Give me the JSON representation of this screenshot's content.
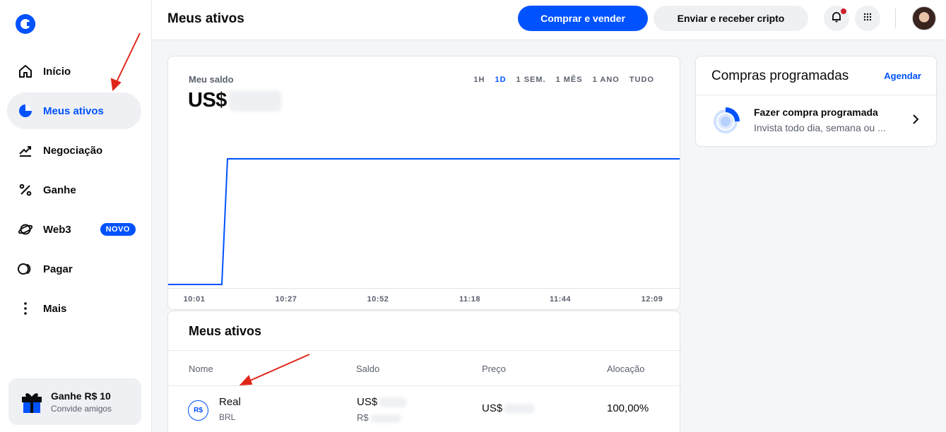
{
  "sidebar": {
    "items": [
      {
        "label": "Início",
        "icon": "home-icon"
      },
      {
        "label": "Meus ativos",
        "icon": "pie-chart-icon"
      },
      {
        "label": "Negociação",
        "icon": "trend-icon"
      },
      {
        "label": "Ganhe",
        "icon": "percent-icon"
      },
      {
        "label": "Web3",
        "icon": "planet-icon",
        "badge": "NOVO"
      },
      {
        "label": "Pagar",
        "icon": "pay-icon"
      },
      {
        "label": "Mais",
        "icon": "more-vertical-icon"
      }
    ],
    "promo": {
      "title": "Ganhe R$ 10",
      "subtitle": "Convide amigos"
    }
  },
  "header": {
    "title": "Meus ativos",
    "buy_sell": "Comprar e vender",
    "send_receive": "Enviar e receber cripto"
  },
  "balance": {
    "label": "Meu saldo",
    "currency": "US$",
    "ranges": [
      "1H",
      "1D",
      "1 SEM.",
      "1 MÊS",
      "1 ANO",
      "TUDO"
    ],
    "active_range": "1D"
  },
  "chart_data": {
    "type": "line",
    "x_ticks": [
      "10:01",
      "10:27",
      "10:52",
      "11:18",
      "11:44",
      "12:09"
    ],
    "series": [
      {
        "values_normalized": [
          0,
          0,
          1,
          1,
          1,
          1
        ]
      }
    ],
    "grid": false,
    "color": "#0052ff"
  },
  "assets": {
    "title": "Meus ativos",
    "columns": [
      "Nome",
      "Saldo",
      "Preço",
      "Alocação"
    ],
    "rows": [
      {
        "coin_badge": "R$",
        "name": "Real",
        "symbol": "BRL",
        "balance_main": "US$",
        "balance_sub": "R$",
        "price": "US$",
        "allocation": "100,00%"
      }
    ]
  },
  "scheduled": {
    "title": "Compras programadas",
    "link": "Agendar",
    "item_title": "Fazer compra programada",
    "item_sub": "Invista todo dia, semana ou ..."
  },
  "colors": {
    "accent": "#0052ff",
    "annotation": "#e0261b"
  }
}
